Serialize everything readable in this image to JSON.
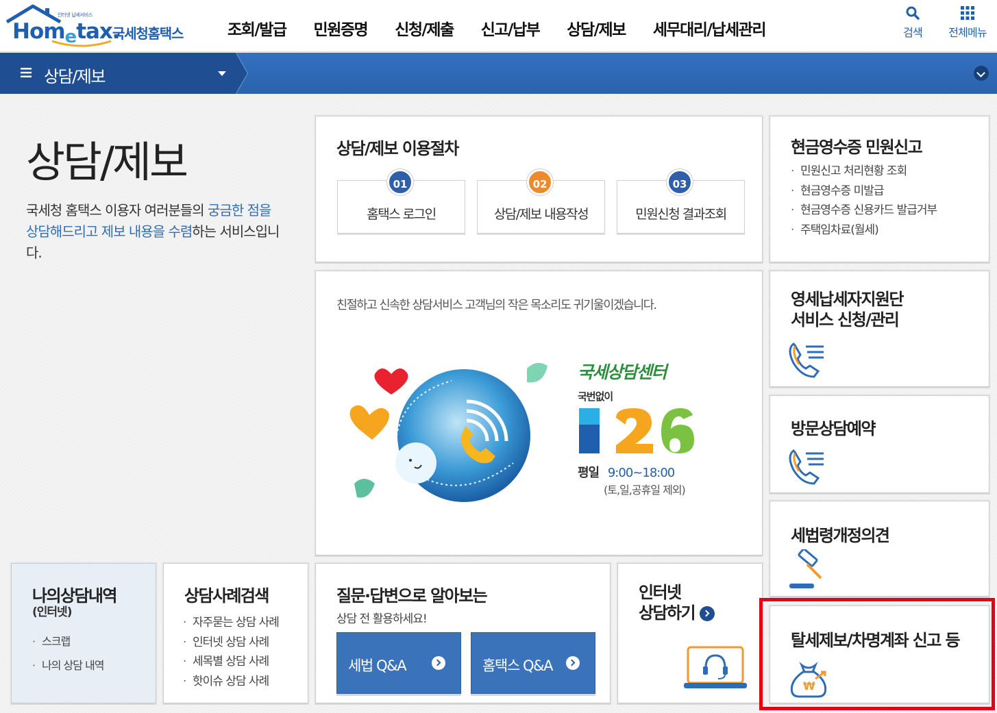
{
  "header": {
    "logo_tiny": "인터넷 납세서비스",
    "logo_brand_a": "Hom",
    "logo_brand_e": "e",
    "logo_brand_b": "tax.",
    "logo_name": "국세청홈택스",
    "menu": [
      "조회/발급",
      "민원증명",
      "신청/제출",
      "신고/납부",
      "상담/제보",
      "세무대리/납세관리"
    ],
    "search_label": "검색",
    "all_menu_label": "전체메뉴"
  },
  "subbar": {
    "title": "상담/제보"
  },
  "intro": {
    "heading": "상담/제보",
    "text_1": "국세청 홈택스 이용자 여러분들의 ",
    "text_hl": "궁금한 점을 상담해드리고 제보 내용을 수렴",
    "text_2": "하는 서비스입니다."
  },
  "procedure": {
    "title": "상담/제보 이용절차",
    "steps": [
      {
        "num": "01",
        "label": "홈택스 로그인",
        "color": "#2f5fa8"
      },
      {
        "num": "02",
        "label": "상담/제보 내용작성",
        "color": "#f0892b"
      },
      {
        "num": "03",
        "label": "민원신청 결과조회",
        "color": "#2f5fa8"
      }
    ]
  },
  "cash_receipt": {
    "title": "현금영수증 민원신고",
    "items": [
      "민원신고 처리현황 조회",
      "현금영수증 미발급",
      "현금영수증 신용카드 발급거부",
      "주택임차료(월세)"
    ]
  },
  "center": {
    "slogan": "친절하고 신속한 상담서비스 고객님의 작은 목소리도 귀기울이겠습니다.",
    "name": "국세상담센터",
    "sub": "국번없이",
    "number": "126",
    "hours_label": "평일",
    "hours": "9:00~18:00",
    "note": "(토,일,공휴일 제외)"
  },
  "right_cards": {
    "small_biz_line1": "영세납세자지원단",
    "small_biz_line2": "서비스 신청/관리",
    "visit": "방문상담예약",
    "law": "세법령개정의견",
    "report": "탈세제보/차명계좌 신고 등"
  },
  "my_history": {
    "title": "나의상담내역",
    "sub": "(인터넷)",
    "items": [
      "스크랩",
      "나의 상담 내역"
    ]
  },
  "cases": {
    "title": "상담사례검색",
    "items": [
      "자주묻는 상담 사례",
      "인터넷 상담 사례",
      "세목별 상담 사례",
      "핫이슈 상담 사례"
    ]
  },
  "qna": {
    "title": "질문·답변으로 알아보는",
    "sub": "상담 전 활용하세요!",
    "btn1": "세법 Q&A",
    "btn2": "홈택스 Q&A"
  },
  "internet": {
    "line1": "인터넷",
    "line2": "상담하기"
  }
}
